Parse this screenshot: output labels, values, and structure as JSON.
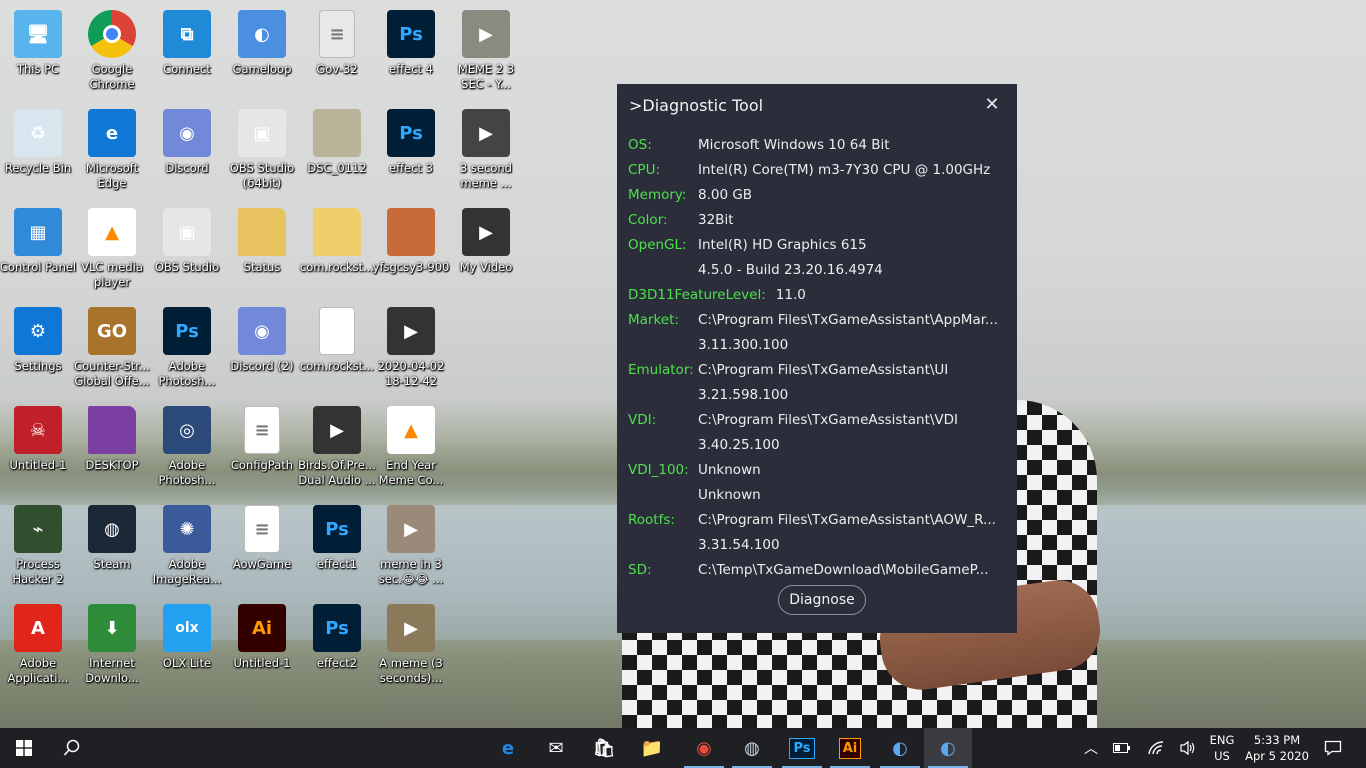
{
  "desktop": {
    "icons": [
      {
        "label": "This PC",
        "col": 0,
        "row": 0,
        "icon": "computer-icon",
        "bg": "#58b4ec",
        "glyph": "🖥"
      },
      {
        "label": "Google Chrome",
        "col": 1,
        "row": 0,
        "icon": "chrome-icon",
        "bg": "#ffffff",
        "glyph": ""
      },
      {
        "label": "Connect",
        "col": 2,
        "row": 0,
        "icon": "connect-icon",
        "bg": "#1f8bd6",
        "glyph": "⧉"
      },
      {
        "label": "Gameloop",
        "col": 3,
        "row": 0,
        "icon": "gameloop-icon",
        "bg": "#4a8fe0",
        "glyph": "◐"
      },
      {
        "label": "Gov-32",
        "col": 4,
        "row": 0,
        "icon": "document-icon",
        "bg": "#e8e8e8",
        "glyph": "≡"
      },
      {
        "label": "effect 4",
        "col": 5,
        "row": 0,
        "icon": "psd-file-icon",
        "bg": "#001e36",
        "glyph": "Ps"
      },
      {
        "label": "MEME 2 3 SEC - Y...",
        "col": 6,
        "row": 0,
        "icon": "video-file-icon",
        "bg": "#8a8a80",
        "glyph": "▶"
      },
      {
        "label": "Recycle Bin",
        "col": 0,
        "row": 1,
        "icon": "recycle-bin-icon",
        "bg": "#d8e6f0",
        "glyph": "♻"
      },
      {
        "label": "Microsoft Edge",
        "col": 1,
        "row": 1,
        "icon": "edge-icon",
        "bg": "#0f78d7",
        "glyph": "e"
      },
      {
        "label": "Discord",
        "col": 2,
        "row": 1,
        "icon": "discord-icon",
        "bg": "#7289da",
        "glyph": "◉"
      },
      {
        "label": "OBS Studio (64bit)",
        "col": 3,
        "row": 1,
        "icon": "obs-icon",
        "bg": "#e6e6e6",
        "glyph": "▣"
      },
      {
        "label": "DSC_0112",
        "col": 4,
        "row": 1,
        "icon": "photo-icon",
        "bg": "#b9b39a",
        "glyph": ""
      },
      {
        "label": "effect 3",
        "col": 5,
        "row": 1,
        "icon": "psd-file-icon",
        "bg": "#001e36",
        "glyph": "Ps"
      },
      {
        "label": "3 second meme ...",
        "col": 6,
        "row": 1,
        "icon": "video-file-icon",
        "bg": "#444444",
        "glyph": "▶"
      },
      {
        "label": "Control Panel",
        "col": 0,
        "row": 2,
        "icon": "control-panel-icon",
        "bg": "#2f8ad8",
        "glyph": "▦"
      },
      {
        "label": "VLC media player",
        "col": 1,
        "row": 2,
        "icon": "vlc-icon",
        "bg": "#ffffff",
        "glyph": "▲"
      },
      {
        "label": "OBS Studio",
        "col": 2,
        "row": 2,
        "icon": "obs-icon",
        "bg": "#e6e6e6",
        "glyph": "▣"
      },
      {
        "label": "Status",
        "col": 3,
        "row": 2,
        "icon": "folder-icon",
        "bg": "#e8c25e",
        "glyph": ""
      },
      {
        "label": "com.rockst...",
        "col": 4,
        "row": 2,
        "icon": "folder-icon",
        "bg": "#f0cd6c",
        "glyph": ""
      },
      {
        "label": "yfsgcsy3-900",
        "col": 5,
        "row": 2,
        "icon": "photo-icon",
        "bg": "#c86a3a",
        "glyph": ""
      },
      {
        "label": "My Video",
        "col": 6,
        "row": 2,
        "icon": "video-file-icon",
        "bg": "#333333",
        "glyph": "▶"
      },
      {
        "label": "Settings",
        "col": 0,
        "row": 3,
        "icon": "gear-icon",
        "bg": "#0f78d7",
        "glyph": "⚙"
      },
      {
        "label": "Counter-Str... Global Offe...",
        "col": 1,
        "row": 3,
        "icon": "csgo-icon",
        "bg": "#a8742d",
        "glyph": "GO"
      },
      {
        "label": "Adobe Photosh...",
        "col": 2,
        "row": 3,
        "icon": "photoshop-icon",
        "bg": "#001e36",
        "glyph": "Ps"
      },
      {
        "label": "Discord (2)",
        "col": 3,
        "row": 3,
        "icon": "discord-icon",
        "bg": "#7289da",
        "glyph": "◉"
      },
      {
        "label": "com.rockst...",
        "col": 4,
        "row": 3,
        "icon": "blank-file-icon",
        "bg": "#ffffff",
        "glyph": ""
      },
      {
        "label": "2020-04-02 18-12-42",
        "col": 5,
        "row": 3,
        "icon": "video-file-icon",
        "bg": "#333333",
        "glyph": "▶"
      },
      {
        "label": "Untitled-1",
        "col": 0,
        "row": 4,
        "icon": "red-app-icon",
        "bg": "#c0202a",
        "glyph": "☠"
      },
      {
        "label": "DESKTOP",
        "col": 1,
        "row": 4,
        "icon": "folder-icon",
        "bg": "#7a3fa0",
        "glyph": ""
      },
      {
        "label": "Adobe Photosh...",
        "col": 2,
        "row": 4,
        "icon": "photoshop-eye-icon",
        "bg": "#2b4a7a",
        "glyph": "◎"
      },
      {
        "label": "ConfigPath",
        "col": 3,
        "row": 4,
        "icon": "web-document-icon",
        "bg": "#ffffff",
        "glyph": "≡"
      },
      {
        "label": "Birds.Of.Pre... Dual Audio ...",
        "col": 4,
        "row": 4,
        "icon": "video-file-icon",
        "bg": "#333333",
        "glyph": "▶"
      },
      {
        "label": "End Year Meme Co...",
        "col": 5,
        "row": 4,
        "icon": "vlc-icon",
        "bg": "#ffffff",
        "glyph": "▲"
      },
      {
        "label": "Process Hacker 2",
        "col": 0,
        "row": 5,
        "icon": "process-hacker-icon",
        "bg": "#2f4f2f",
        "glyph": "⌁"
      },
      {
        "label": "Steam",
        "col": 1,
        "row": 5,
        "icon": "steam-icon",
        "bg": "#1b2838",
        "glyph": "◍"
      },
      {
        "label": "Adobe ImageRea...",
        "col": 2,
        "row": 5,
        "icon": "imageready-icon",
        "bg": "#3a5a9a",
        "glyph": "✺"
      },
      {
        "label": "AowGame",
        "col": 3,
        "row": 5,
        "icon": "web-document-icon",
        "bg": "#ffffff",
        "glyph": "≡"
      },
      {
        "label": "effect1",
        "col": 4,
        "row": 5,
        "icon": "psd-file-icon",
        "bg": "#001e36",
        "glyph": "Ps"
      },
      {
        "label": "meme in 3 sec.😂😂 ...",
        "col": 5,
        "row": 5,
        "icon": "video-file-icon",
        "bg": "#9a8a7a",
        "glyph": "▶"
      },
      {
        "label": "Adobe Applicati...",
        "col": 0,
        "row": 6,
        "icon": "adobe-icon",
        "bg": "#e0251b",
        "glyph": "A"
      },
      {
        "label": "Internet Downlo...",
        "col": 1,
        "row": 6,
        "icon": "idm-icon",
        "bg": "#2e8b3a",
        "glyph": "⬇"
      },
      {
        "label": "OLX Lite",
        "col": 2,
        "row": 6,
        "icon": "olx-icon",
        "bg": "#23a0f0",
        "glyph": "olx"
      },
      {
        "label": "Untitled-1",
        "col": 3,
        "row": 6,
        "icon": "illustrator-file-icon",
        "bg": "#330000",
        "glyph": "Ai"
      },
      {
        "label": "effect2",
        "col": 4,
        "row": 6,
        "icon": "psd-file-icon",
        "bg": "#001e36",
        "glyph": "Ps"
      },
      {
        "label": "A meme (3 seconds)...",
        "col": 5,
        "row": 6,
        "icon": "video-file-icon",
        "bg": "#8a7a5a",
        "glyph": "▶"
      }
    ]
  },
  "dialog": {
    "title": ">Diagnostic Tool",
    "close_glyph": "✕",
    "rows": [
      {
        "key": "OS:",
        "value": "Microsoft Windows  10  64 Bit"
      },
      {
        "key": "CPU:",
        "value": "Intel(R) Core(TM) m3-7Y30 CPU @ 1.00GHz"
      },
      {
        "key": "Memory:",
        "value": "8.00 GB"
      },
      {
        "key": "Color:",
        "value": "32Bit"
      },
      {
        "key": "OpenGL:",
        "value": "Intel(R) HD Graphics 615"
      },
      {
        "key": "",
        "value": "4.5.0 - Build 23.20.16.4974"
      },
      {
        "key": "D3D11FeatureLevel:",
        "value": "11.0",
        "wide": true
      },
      {
        "key": "Market:",
        "value": "C:\\Program Files\\TxGameAssistant\\AppMar..."
      },
      {
        "key": "",
        "value": "3.11.300.100"
      },
      {
        "key": "Emulator:",
        "value": "C:\\Program Files\\TxGameAssistant\\UI"
      },
      {
        "key": "",
        "value": "3.21.598.100"
      },
      {
        "key": "VDI:",
        "value": "C:\\Program Files\\TxGameAssistant\\VDI"
      },
      {
        "key": "",
        "value": "3.40.25.100"
      },
      {
        "key": "VDI_100:",
        "value": "Unknown"
      },
      {
        "key": "",
        "value": "Unknown"
      },
      {
        "key": "Rootfs:",
        "value": "C:\\Program Files\\TxGameAssistant\\AOW_R..."
      },
      {
        "key": "",
        "value": "3.31.54.100"
      },
      {
        "key": "SD:",
        "value": "C:\\Temp\\TxGameDownload\\MobileGameP..."
      }
    ],
    "diagnose_label": "Diagnose",
    "key_color": "#4de04d",
    "bg_color": "#2b2e3a"
  },
  "taskbar": {
    "pinned": [
      {
        "name": "taskbar-edge",
        "icon": "edge-icon",
        "glyph": "e",
        "color": "#1e88e5"
      },
      {
        "name": "taskbar-mail",
        "icon": "mail-icon",
        "glyph": "✉",
        "color": "#ffffff"
      },
      {
        "name": "taskbar-store",
        "icon": "store-icon",
        "glyph": "🛍",
        "color": "#ffffff"
      },
      {
        "name": "taskbar-explorer",
        "icon": "folder-icon",
        "glyph": "📁",
        "color": "#f2c14e"
      },
      {
        "name": "taskbar-chrome",
        "icon": "chrome-icon",
        "glyph": "◉",
        "color": "#e74c3c"
      },
      {
        "name": "taskbar-steam",
        "icon": "steam-icon",
        "glyph": "◍",
        "color": "#c6d4df"
      },
      {
        "name": "taskbar-photoshop",
        "icon": "photoshop-icon",
        "glyph": "Ps",
        "color": "#31a8ff"
      },
      {
        "name": "taskbar-illustrator",
        "icon": "illustrator-icon",
        "glyph": "Ai",
        "color": "#ff9a00"
      },
      {
        "name": "taskbar-gameloop",
        "icon": "gameloop-icon",
        "glyph": "◐",
        "color": "#5aa9f0"
      },
      {
        "name": "taskbar-gameloop-2",
        "icon": "gameloop-icon",
        "glyph": "◐",
        "color": "#5aa9f0"
      }
    ],
    "language_line1": "ENG",
    "language_line2": "US",
    "time": "5:33 PM",
    "date": "Apr 5 2020"
  }
}
